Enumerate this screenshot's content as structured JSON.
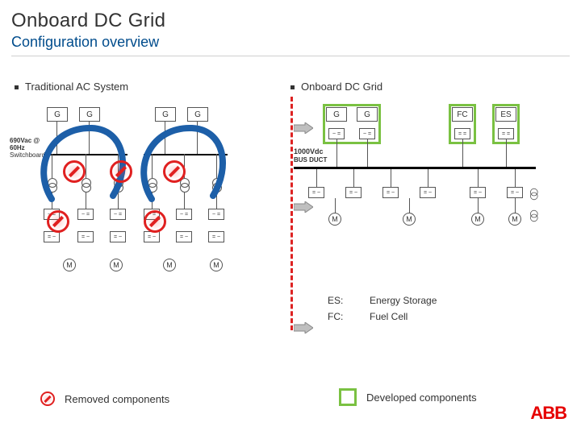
{
  "title": "Onboard DC Grid",
  "subtitle": "Configuration overview",
  "left": {
    "heading": "Traditional AC System",
    "bus_label_line1": "690Vac @",
    "bus_label_line2": "60Hz",
    "bus_label_line3": "Switchboard",
    "gen_labels": [
      "G",
      "G",
      "G",
      "G"
    ],
    "motor_labels": [
      "M",
      "M",
      "M",
      "M"
    ]
  },
  "right": {
    "heading": "Onboard DC Grid",
    "gen_labels": [
      "G",
      "G"
    ],
    "fc_label": "FC",
    "es_label": "ES",
    "bus_label": "1000Vdc",
    "bus_sublabel": "BUS DUCT",
    "motor_labels": [
      "M",
      "M",
      "M",
      "M"
    ]
  },
  "abbr": {
    "es_key": "ES:",
    "es_val": "Energy Storage",
    "fc_key": "FC:",
    "fc_val": "Fuel Cell"
  },
  "legend": {
    "removed": "Removed components",
    "developed": "Developed components"
  },
  "brand": "ABB",
  "colors": {
    "accent_green": "#7ac142",
    "accent_red": "#e02020",
    "brand_red": "#e60000",
    "link_blue": "#004c8c"
  }
}
